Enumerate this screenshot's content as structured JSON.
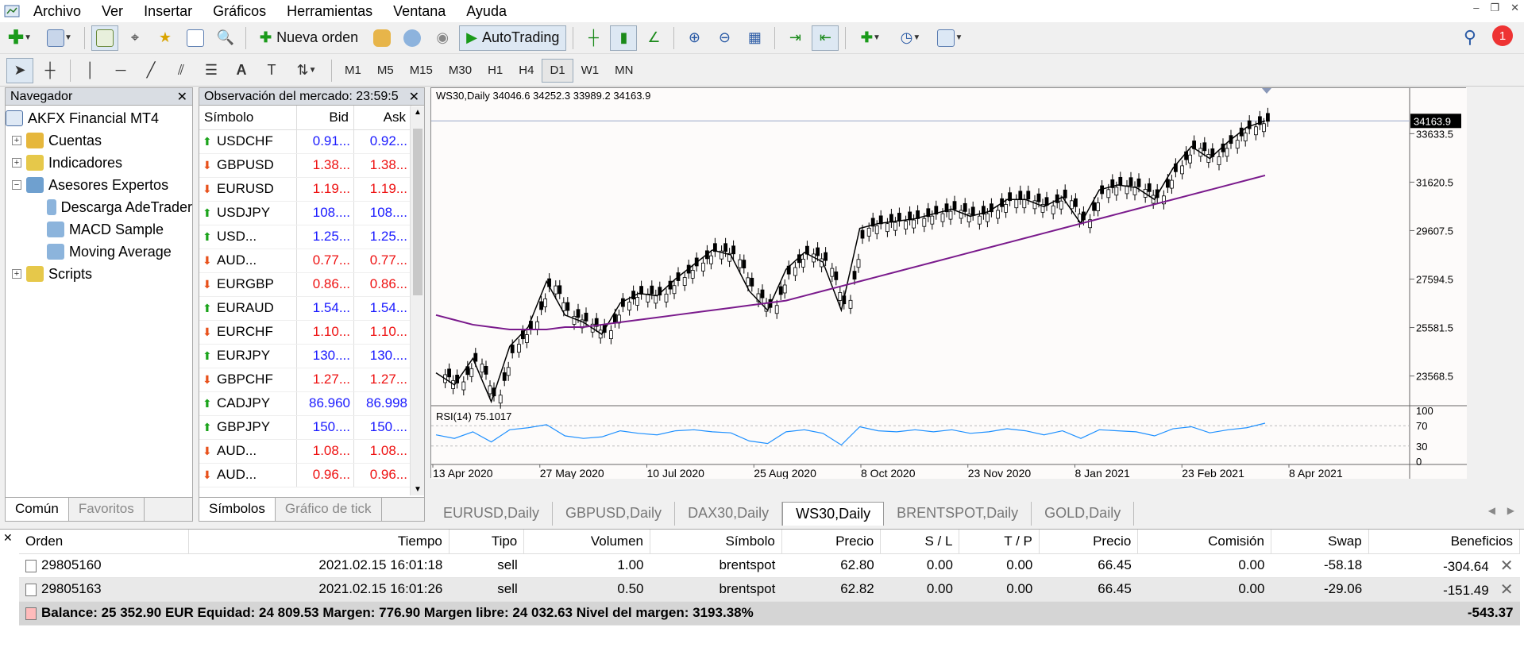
{
  "menu": [
    "Archivo",
    "Ver",
    "Insertar",
    "Gráficos",
    "Herramientas",
    "Ventana",
    "Ayuda"
  ],
  "toolbar": {
    "new_order": "Nueva orden",
    "autotrading": "AutoTrading",
    "notification_count": "1"
  },
  "timeframes": [
    {
      "label": "M1",
      "active": false
    },
    {
      "label": "M5",
      "active": false
    },
    {
      "label": "M15",
      "active": false
    },
    {
      "label": "M30",
      "active": false
    },
    {
      "label": "H1",
      "active": false
    },
    {
      "label": "H4",
      "active": false
    },
    {
      "label": "D1",
      "active": true
    },
    {
      "label": "W1",
      "active": false
    },
    {
      "label": "MN",
      "active": false
    }
  ],
  "navigator": {
    "title": "Navegador",
    "root": "AKFX Financial MT4",
    "items": [
      {
        "label": "Cuentas",
        "level": 1,
        "expander": "+",
        "icon": "accounts-icon"
      },
      {
        "label": "Indicadores",
        "level": 1,
        "expander": "+",
        "icon": "indicators-icon"
      },
      {
        "label": "Asesores Expertos",
        "level": 1,
        "expander": "−",
        "icon": "experts-icon"
      },
      {
        "label": "Descarga AdeTrader",
        "level": 2,
        "expander": "",
        "icon": "expert-icon"
      },
      {
        "label": "MACD Sample",
        "level": 2,
        "expander": "",
        "icon": "expert-icon"
      },
      {
        "label": "Moving Average",
        "level": 2,
        "expander": "",
        "icon": "expert-icon"
      },
      {
        "label": "Scripts",
        "level": 1,
        "expander": "+",
        "icon": "scripts-icon"
      }
    ],
    "tabs": [
      "Común",
      "Favoritos"
    ]
  },
  "market_watch": {
    "title": "Observación del mercado: 23:59:5",
    "columns": [
      "Símbolo",
      "Bid",
      "Ask"
    ],
    "rows": [
      {
        "symbol": "USDCHF",
        "bid": "0.91...",
        "ask": "0.92...",
        "dir": "up"
      },
      {
        "symbol": "GBPUSD",
        "bid": "1.38...",
        "ask": "1.38...",
        "dir": "dn"
      },
      {
        "symbol": "EURUSD",
        "bid": "1.19...",
        "ask": "1.19...",
        "dir": "dn"
      },
      {
        "symbol": "USDJPY",
        "bid": "108....",
        "ask": "108....",
        "dir": "up"
      },
      {
        "symbol": "USD...",
        "bid": "1.25...",
        "ask": "1.25...",
        "dir": "up"
      },
      {
        "symbol": "AUD...",
        "bid": "0.77...",
        "ask": "0.77...",
        "dir": "dn"
      },
      {
        "symbol": "EURGBP",
        "bid": "0.86...",
        "ask": "0.86...",
        "dir": "dn"
      },
      {
        "symbol": "EURAUD",
        "bid": "1.54...",
        "ask": "1.54...",
        "dir": "up"
      },
      {
        "symbol": "EURCHF",
        "bid": "1.10...",
        "ask": "1.10...",
        "dir": "dn"
      },
      {
        "symbol": "EURJPY",
        "bid": "130....",
        "ask": "130....",
        "dir": "up"
      },
      {
        "symbol": "GBPCHF",
        "bid": "1.27...",
        "ask": "1.27...",
        "dir": "dn"
      },
      {
        "symbol": "CADJPY",
        "bid": "86.960",
        "ask": "86.998",
        "dir": "up"
      },
      {
        "symbol": "GBPJPY",
        "bid": "150....",
        "ask": "150....",
        "dir": "up"
      },
      {
        "symbol": "AUD...",
        "bid": "1.08...",
        "ask": "1.08...",
        "dir": "dn"
      },
      {
        "symbol": "AUD...",
        "bid": "0.96...",
        "ask": "0.96...",
        "dir": "dn"
      }
    ],
    "tabs": [
      "Símbolos",
      "Gráfico de tick"
    ]
  },
  "chart_data": {
    "type": "line",
    "title": "WS30,Daily  34046.6 34252.3 33989.2 34163.9",
    "current_price": "34163.9",
    "y_ticks": [
      "33633.5",
      "31620.5",
      "29607.5",
      "27594.5",
      "25581.5",
      "23568.5"
    ],
    "ylim": [
      22400,
      34800
    ],
    "x_ticks": [
      "13 Apr 2020",
      "27 May 2020",
      "10 Jul 2020",
      "25 Aug 2020",
      "8 Oct 2020",
      "23 Nov 2020",
      "8 Jan 2021",
      "23 Feb 2021",
      "8 Apr 2021"
    ],
    "series": [
      {
        "values": [
          23700,
          23200,
          24300,
          22500,
          24800,
          25600,
          27500,
          26100,
          25800,
          25300,
          26600,
          27000,
          26900,
          27600,
          28200,
          28800,
          28600,
          27100,
          26300,
          28000,
          28700,
          28300,
          26300,
          29700,
          29900,
          30000,
          30100,
          30300,
          30500,
          30200,
          30400,
          30900,
          30900,
          30600,
          31000,
          29900,
          31300,
          31500,
          31400,
          30900,
          32200,
          33100,
          32600,
          33300,
          33900,
          34164
        ],
        "color": "#000"
      },
      {
        "values": [
          26100,
          25900,
          25700,
          25600,
          25500,
          25500,
          25500,
          25600,
          25600,
          25700,
          25800,
          25900,
          26000,
          26100,
          26200,
          26300,
          26400,
          26500,
          26600,
          26700,
          26900,
          27100,
          27300,
          27500,
          27700,
          27900,
          28100,
          28300,
          28500,
          28700,
          28900,
          29100,
          29300,
          29500,
          29700,
          29900,
          30100,
          30300,
          30500,
          30700,
          30900,
          31100,
          31300,
          31500,
          31700,
          31900
        ],
        "color": "#7a1a8c"
      }
    ],
    "rsi": {
      "label": "RSI(14) 75.1017",
      "levels": [
        "100",
        "70",
        "30",
        "0"
      ],
      "values": [
        52,
        45,
        58,
        38,
        62,
        66,
        72,
        50,
        45,
        48,
        60,
        55,
        52,
        60,
        62,
        58,
        56,
        40,
        35,
        58,
        62,
        55,
        32,
        68,
        60,
        58,
        62,
        58,
        62,
        55,
        58,
        64,
        60,
        52,
        60,
        45,
        62,
        60,
        58,
        50,
        64,
        68,
        56,
        62,
        66,
        75
      ]
    }
  },
  "chart_tabs": [
    {
      "label": "EURUSD,Daily",
      "active": false
    },
    {
      "label": "GBPUSD,Daily",
      "active": false
    },
    {
      "label": "DAX30,Daily",
      "active": false
    },
    {
      "label": "WS30,Daily",
      "active": true
    },
    {
      "label": "BRENTSPOT,Daily",
      "active": false
    },
    {
      "label": "GOLD,Daily",
      "active": false
    }
  ],
  "terminal": {
    "columns": [
      "Orden",
      "Tiempo",
      "Tipo",
      "Volumen",
      "Símbolo",
      "Precio",
      "S / L",
      "T / P",
      "Precio",
      "Comisión",
      "Swap",
      "Beneficios"
    ],
    "orders": [
      {
        "orden": "29805160",
        "tiempo": "2021.02.15 16:01:18",
        "tipo": "sell",
        "volumen": "1.00",
        "simbolo": "brentspot",
        "precio": "62.80",
        "sl": "0.00",
        "tp": "0.00",
        "precio2": "66.45",
        "comision": "0.00",
        "swap": "-58.18",
        "beneficios": "-304.64"
      },
      {
        "orden": "29805163",
        "tiempo": "2021.02.15 16:01:26",
        "tipo": "sell",
        "volumen": "0.50",
        "simbolo": "brentspot",
        "precio": "62.82",
        "sl": "0.00",
        "tp": "0.00",
        "precio2": "66.45",
        "comision": "0.00",
        "swap": "-29.06",
        "beneficios": "-151.49"
      }
    ],
    "summary": "Balance: 25 352.90 EUR  Equidad: 24 809.53  Margen: 776.90  Margen libre: 24 032.63  Nivel del margen: 3193.38%",
    "total": "-543.37"
  }
}
